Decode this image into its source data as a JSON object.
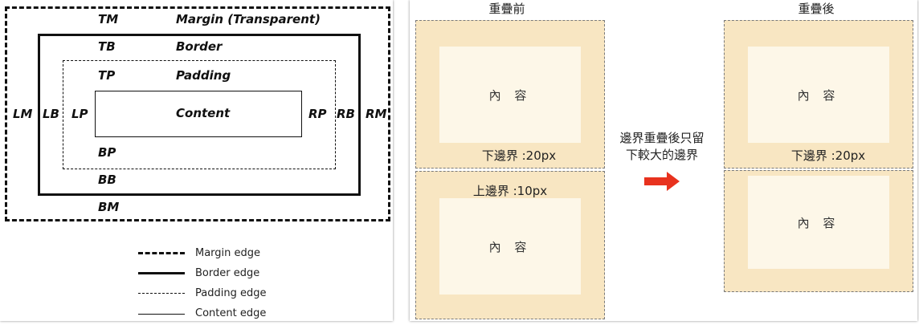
{
  "box_model": {
    "labels": {
      "tm": "TM",
      "tb": "TB",
      "tp": "TP",
      "margin": "Margin (Transparent)",
      "border": "Border",
      "padding": "Padding",
      "content": "Content",
      "lm": "LM",
      "lb": "LB",
      "lp": "LP",
      "rp": "RP",
      "rb": "RB",
      "rm": "RM",
      "bp": "BP",
      "bb": "BB",
      "bm": "BM"
    },
    "legend": [
      {
        "style": "thick-dashed",
        "label": "Margin edge"
      },
      {
        "style": "thick-solid",
        "label": "Border edge"
      },
      {
        "style": "thin-dashed",
        "label": "Padding edge"
      },
      {
        "style": "thin-solid",
        "label": "Content edge"
      }
    ]
  },
  "collapse": {
    "before_title": "重疊前",
    "after_title": "重疊後",
    "content_label": "內 容",
    "bottom_margin_label": "下邊界 :20px",
    "top_margin_label": "上邊界 :10px",
    "explanation_line1": "邊界重疊後只留",
    "explanation_line2": "下較大的邊界",
    "arrow_color": "#e8321e",
    "margin_color": "#f8e6c2",
    "content_color": "#fdf7e8"
  }
}
